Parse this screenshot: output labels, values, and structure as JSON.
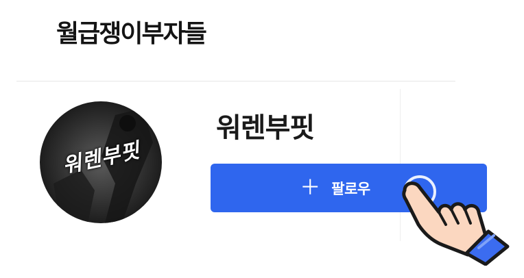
{
  "header": {
    "site_title": "월급쟁이부자들"
  },
  "profile": {
    "name": "워렌부핏",
    "avatar_text": "워렌부핏"
  },
  "follow": {
    "icon": "plus-icon",
    "label": "팔로우",
    "color": "#2f66ee"
  },
  "overlay": {
    "icon": "pointing-hand-icon"
  }
}
